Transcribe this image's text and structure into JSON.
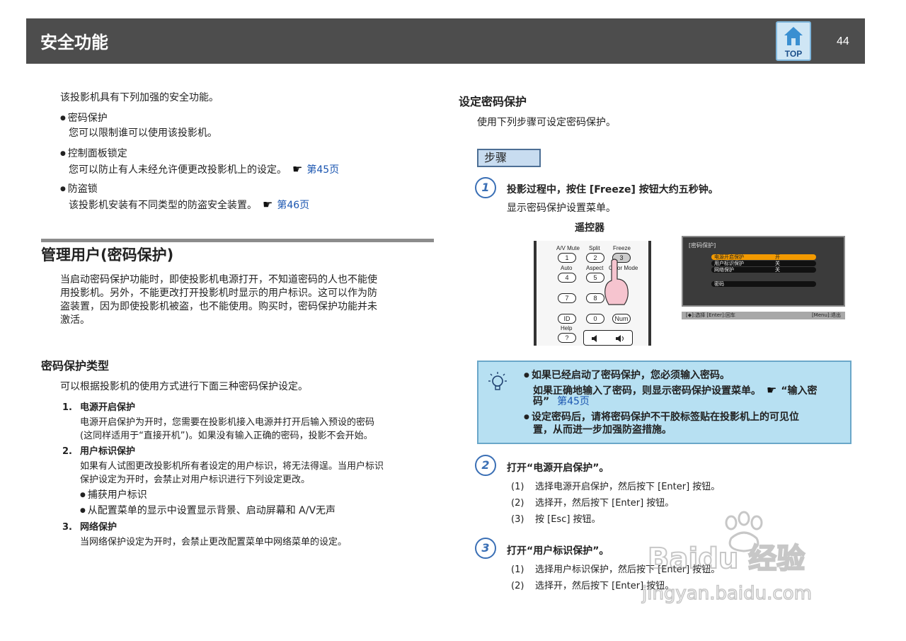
{
  "header": {
    "title": "安全功能",
    "top_label": "TOP",
    "page_number": "44"
  },
  "left": {
    "intro": "该投影机具有下列加强的安全功能。",
    "features": [
      {
        "title": "密码保护",
        "desc": "您可以限制谁可以使用该投影机。",
        "link": ""
      },
      {
        "title": "控制面板锁定",
        "desc": "您可以防止有人未经允许便更改投影机上的设定。",
        "link": "第45页"
      },
      {
        "title": "防盗锁",
        "desc": "该投影机安装有不同类型的防盗安全装置。",
        "link": "第46页"
      }
    ],
    "section_title": "管理用户(密码保护)",
    "section_para": [
      "当启动密码保护功能时，即使投影机电源打开，不知道密码的人也不能使",
      "用投影机。另外，不能更改打开投影机时显示的用户标识。这可以作为防",
      "盗装置，因为即使投影机被盗，也不能使用。购买时，密码保护功能并未",
      "激活。"
    ],
    "types_title": "密码保护类型",
    "types_intro": "可以根据投影机的使用方式进行下面三种密码保护设定。",
    "types": [
      {
        "num": "1.",
        "title": "电源开启保护",
        "lines": [
          "电源开启保护为开时，您需要在投影机接入电源并打开后输入预设的密码",
          "(这同样适用于“直接开机”)。如果没有输入正确的密码，投影不会开始。"
        ]
      },
      {
        "num": "2.",
        "title": "用户标识保护",
        "lines": [
          "如果有人试图更改投影机所有者设定的用户标识，将无法得逞。当用户标识",
          "保护设定为开时，会禁止对用户标识进行下列设定更改。"
        ],
        "bullets": [
          "捕获用户标识",
          "从配置菜单的显示中设置显示背景、启动屏幕和  A/V无声"
        ]
      },
      {
        "num": "3.",
        "title": "网络保护",
        "lines": [
          "当网络保护设定为开时，会禁止更改配置菜单中网络菜单的设定。"
        ]
      }
    ]
  },
  "right": {
    "title": "设定密码保护",
    "intro": "使用下列步骤可设定密码保护。",
    "steps_label": "步骤",
    "step1": {
      "num": "1",
      "title": "投影过程中，按住 [Freeze] 按钮大约五秒钟。",
      "desc": "显示密码保护设置菜单。"
    },
    "remote_caption": "遥控器",
    "remote_buttons": [
      "A/V Mute",
      "Split",
      "Freeze",
      "1",
      "2",
      "3",
      "Auto",
      "Aspect",
      "Color Mode",
      "4",
      "5",
      "7",
      "8",
      "ID",
      "0",
      "Num",
      "Help",
      "?"
    ],
    "menu": {
      "title": "[密码保护]",
      "rows": [
        {
          "label": "电源开启保护",
          "value": "开"
        },
        {
          "label": "用户标识保护",
          "value": "关"
        },
        {
          "label": "网络保护",
          "value": "关"
        },
        {
          "label": "密码",
          "value": ""
        }
      ],
      "footer_left": "[◆]:选择 [Enter]:回车",
      "footer_right": "[Menu]:退出"
    },
    "tip": {
      "b1_l1": "如果已经启动了密码保护，您必须输入密码。",
      "b1_l2": "如果正确地输入了密码，则显示密码保护设置菜单。",
      "b1_link_pre": "“输入密",
      "b1_l3a": "码”",
      "b1_link": "第45页",
      "b2_l1": "设定密码后，请将密码保护不干胶标签贴在投影机上的可见位",
      "b2_l2": "置，从而进一步加强防盗措施。"
    },
    "step2": {
      "num": "2",
      "title": "打开“电源开启保护”。",
      "items": [
        {
          "n": "(1)",
          "text": "选择电源开启保护，然后按下 [Enter] 按钮。"
        },
        {
          "n": "(2)",
          "text": "选择开，然后按下 [Enter] 按钮。"
        },
        {
          "n": "(3)",
          "text": "按 [Esc] 按钮。"
        }
      ]
    },
    "step3": {
      "num": "3",
      "title": "打开“用户标识保护”。",
      "items": [
        {
          "n": "(1)",
          "text": "选择用户标识保护，然后按下 [Enter] 按钮。"
        },
        {
          "n": "(2)",
          "text": "选择开，然后按下 [Enter] 按钮。"
        }
      ]
    }
  },
  "watermark": {
    "line1": "Baidu 经验",
    "line2": "jingyan.baidu.com"
  }
}
